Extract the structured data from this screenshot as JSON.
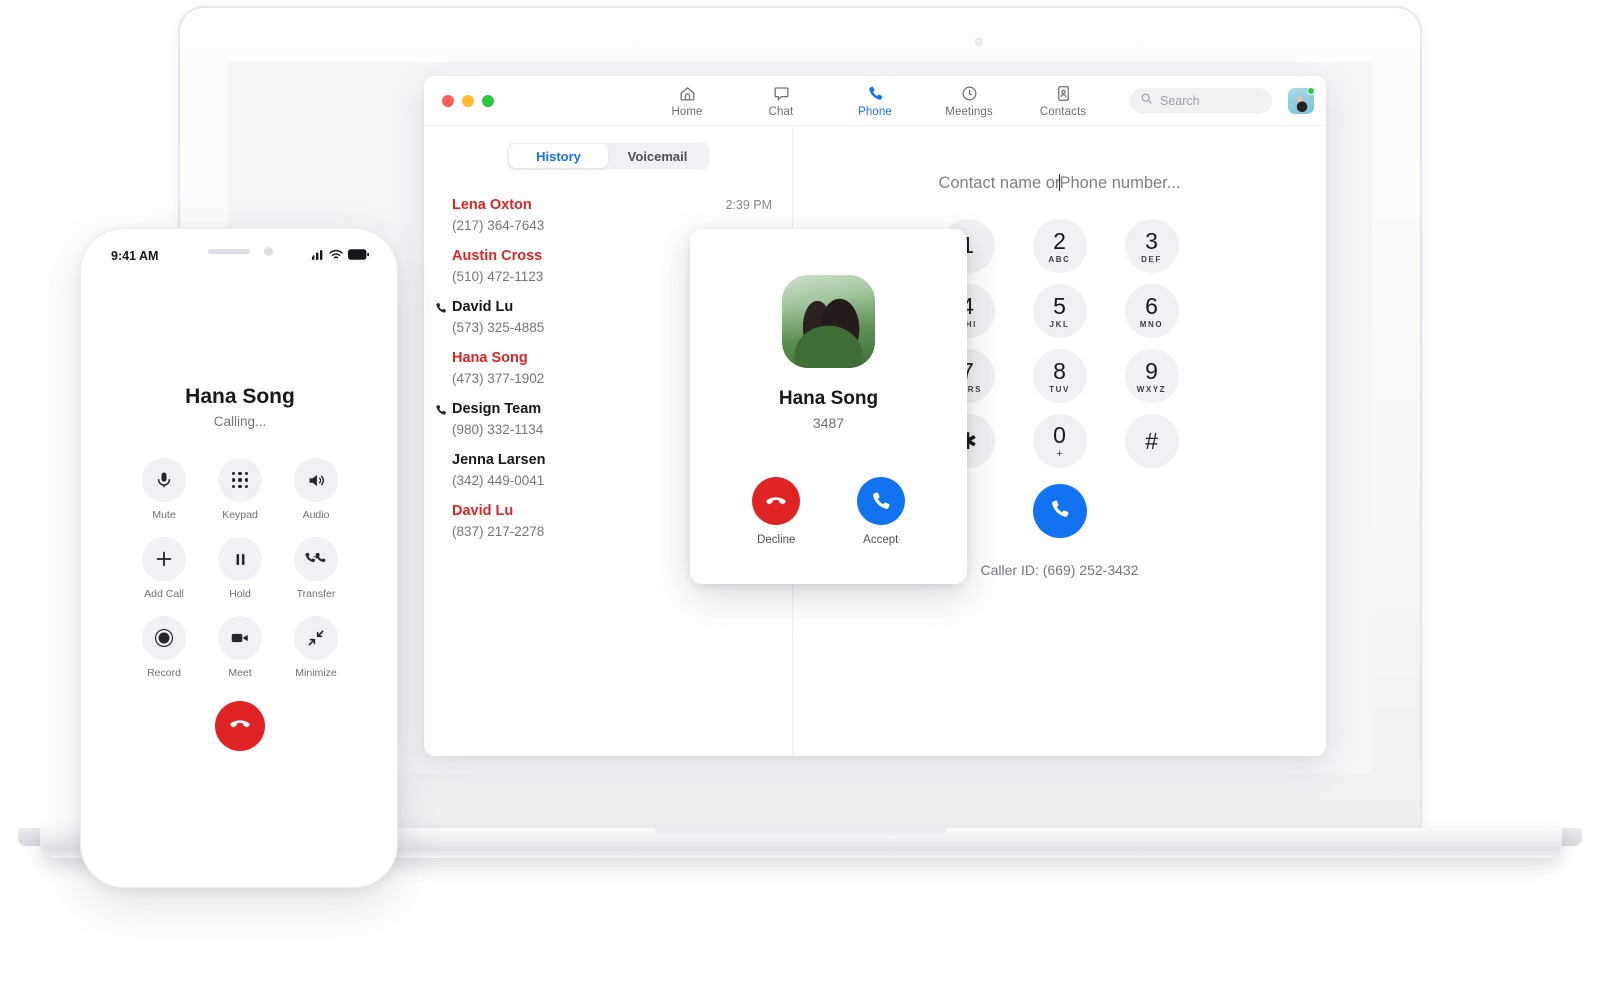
{
  "app": {
    "window_controls": [
      "close",
      "minimize",
      "maximize"
    ],
    "nav": [
      {
        "label": "Home",
        "icon": "home-icon",
        "active": false
      },
      {
        "label": "Chat",
        "icon": "chat-icon",
        "active": false
      },
      {
        "label": "Phone",
        "icon": "phone-icon",
        "active": true
      },
      {
        "label": "Meetings",
        "icon": "clock-icon",
        "active": false
      },
      {
        "label": "Contacts",
        "icon": "contacts-icon",
        "active": false
      }
    ],
    "search": {
      "placeholder": "Search",
      "icon": "search-icon"
    },
    "avatar": {
      "name": "avatar",
      "status": "online",
      "status_color": "#28c840"
    },
    "accent_color": "#1273f0",
    "missed_color": "#e02424"
  },
  "left_pane": {
    "tabs": [
      {
        "label": "History",
        "active": true
      },
      {
        "label": "Voicemail",
        "active": false
      }
    ],
    "calls": [
      {
        "name": "Lena Oxton",
        "number": "(217) 364-7643",
        "missed": true,
        "outgoing": false,
        "time": "2:39 PM"
      },
      {
        "name": "Austin Cross",
        "number": "(510) 472-1123",
        "missed": true,
        "outgoing": false,
        "time": ""
      },
      {
        "name": "David Lu",
        "number": "(573) 325-4885",
        "missed": false,
        "outgoing": true,
        "time": ""
      },
      {
        "name": "Hana Song",
        "number": "(473) 377-1902",
        "missed": true,
        "outgoing": false,
        "time": ""
      },
      {
        "name": "Design Team",
        "number": "(980) 332-1134",
        "missed": false,
        "outgoing": true,
        "time": ""
      },
      {
        "name": "Jenna Larsen",
        "number": "(342) 449-0041",
        "missed": false,
        "outgoing": false,
        "time": ""
      },
      {
        "name": "David Lu",
        "number": "(837) 217-2278",
        "missed": true,
        "outgoing": false,
        "time": ""
      }
    ]
  },
  "dialpad": {
    "input_placeholder": "Contact name or Phone number...",
    "input_placeholder_before": "Contact name or",
    "input_placeholder_after": "Phone number...",
    "keys": [
      {
        "digit": "1",
        "sub": ""
      },
      {
        "digit": "2",
        "sub": "ABC"
      },
      {
        "digit": "3",
        "sub": "DEF"
      },
      {
        "digit": "4",
        "sub": "GHI"
      },
      {
        "digit": "5",
        "sub": "JKL"
      },
      {
        "digit": "6",
        "sub": "MNO"
      },
      {
        "digit": "7",
        "sub": "PQRS"
      },
      {
        "digit": "8",
        "sub": "TUV"
      },
      {
        "digit": "9",
        "sub": "WXYZ"
      },
      {
        "digit": "✱",
        "sub": ""
      },
      {
        "digit": "0",
        "sub": "+"
      },
      {
        "digit": "#",
        "sub": ""
      }
    ],
    "call_button_icon": "phone-icon",
    "caller_id": "Caller ID: (669) 252-3432"
  },
  "incoming_call": {
    "name": "Hana Song",
    "extension": "3487",
    "decline_label": "Decline",
    "accept_label": "Accept",
    "decline_icon": "phone-hangup-icon",
    "accept_icon": "phone-icon",
    "decline_color": "#e02424",
    "accept_color": "#1273f0"
  },
  "phone_mockup": {
    "status": {
      "time": "9:41 AM",
      "cellular_icon": "signal-bars-icon",
      "wifi_icon": "wifi-icon",
      "battery_icon": "battery-icon"
    },
    "caller_name": "Hana Song",
    "call_state": "Calling...",
    "controls": [
      {
        "label": "Mute",
        "icon": "microphone-icon"
      },
      {
        "label": "Keypad",
        "icon": "dialpad-icon"
      },
      {
        "label": "Audio",
        "icon": "speaker-icon"
      },
      {
        "label": "Add Call",
        "icon": "plus-icon"
      },
      {
        "label": "Hold",
        "icon": "pause-icon"
      },
      {
        "label": "Transfer",
        "icon": "transfer-icon"
      },
      {
        "label": "Record",
        "icon": "record-icon"
      },
      {
        "label": "Meet",
        "icon": "video-camera-icon"
      },
      {
        "label": "Minimize",
        "icon": "minimize-icon"
      }
    ],
    "end_call_icon": "phone-hangup-icon",
    "end_call_color": "#e02424"
  }
}
